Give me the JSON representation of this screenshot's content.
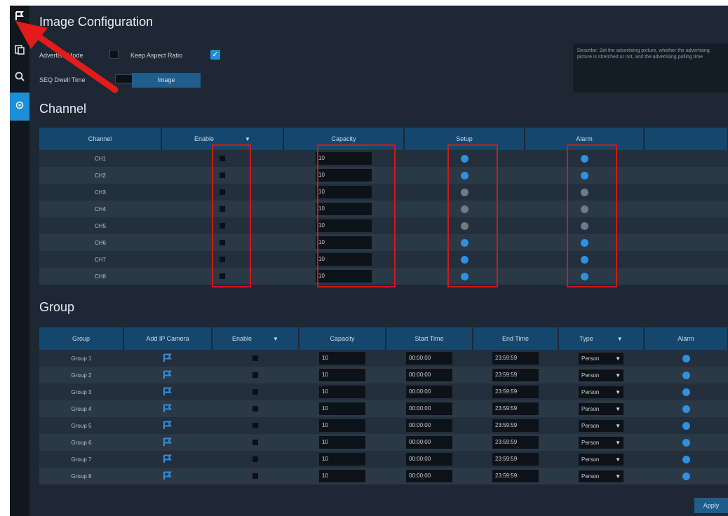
{
  "sidebar": {
    "items": [
      {
        "icon": "flag-icon",
        "active": false
      },
      {
        "icon": "document-icon",
        "active": false
      },
      {
        "icon": "search-icon",
        "active": false
      },
      {
        "icon": "gear-icon",
        "active": true
      }
    ]
  },
  "image_config": {
    "title": "Image Configuration",
    "advertise_mode_label": "Advertise Mode",
    "keep_aspect_label": "Keep Aspect Ratio",
    "seq_dwell_label": "SEQ Dwell Time",
    "image_button": "Image",
    "description": "Describe: Set the advertising picture, whether the advertising picture is stretched or not, and the advertising polling time"
  },
  "channel": {
    "title": "Channel",
    "headers": [
      "Channel",
      "Enable",
      "Capacity",
      "Setup",
      "Alarm"
    ],
    "rows": [
      {
        "name": "CH1",
        "capacity": "10",
        "setup": "blue",
        "alarm": "blue"
      },
      {
        "name": "CH2",
        "capacity": "10",
        "setup": "blue",
        "alarm": "blue"
      },
      {
        "name": "CH3",
        "capacity": "10",
        "setup": "grey",
        "alarm": "grey"
      },
      {
        "name": "CH4",
        "capacity": "10",
        "setup": "grey",
        "alarm": "grey"
      },
      {
        "name": "CH5",
        "capacity": "10",
        "setup": "grey",
        "alarm": "grey"
      },
      {
        "name": "CH6",
        "capacity": "10",
        "setup": "blue",
        "alarm": "blue"
      },
      {
        "name": "CH7",
        "capacity": "10",
        "setup": "blue",
        "alarm": "blue"
      },
      {
        "name": "CH8",
        "capacity": "10",
        "setup": "blue",
        "alarm": "blue"
      }
    ]
  },
  "group": {
    "title": "Group",
    "headers": [
      "Group",
      "Add IP Camera",
      "Enable",
      "Capacity",
      "Start Time",
      "End Time",
      "Type",
      "Alarm"
    ],
    "rows": [
      {
        "name": "Group 1",
        "capacity": "10",
        "start": "00:00:00",
        "end": "23:59:59",
        "type": "Person"
      },
      {
        "name": "Group 2",
        "capacity": "10",
        "start": "00:00:00",
        "end": "23:59:59",
        "type": "Person"
      },
      {
        "name": "Group 3",
        "capacity": "10",
        "start": "00:00:00",
        "end": "23:59:59",
        "type": "Person"
      },
      {
        "name": "Group 4",
        "capacity": "10",
        "start": "00:00:00",
        "end": "23:59:59",
        "type": "Person"
      },
      {
        "name": "Group 5",
        "capacity": "10",
        "start": "00:00:00",
        "end": "23:59:59",
        "type": "Person"
      },
      {
        "name": "Group 6",
        "capacity": "10",
        "start": "00:00:00",
        "end": "23:59:59",
        "type": "Person"
      },
      {
        "name": "Group 7",
        "capacity": "10",
        "start": "00:00:00",
        "end": "23:59:59",
        "type": "Person"
      },
      {
        "name": "Group 8",
        "capacity": "10",
        "start": "00:00:00",
        "end": "23:59:59",
        "type": "Person"
      }
    ]
  },
  "apply_button": "Apply",
  "colors": {
    "accent": "#1e8ed8",
    "header": "#15476e",
    "highlight": "#d0191c",
    "arrow": "#e31b1b"
  }
}
